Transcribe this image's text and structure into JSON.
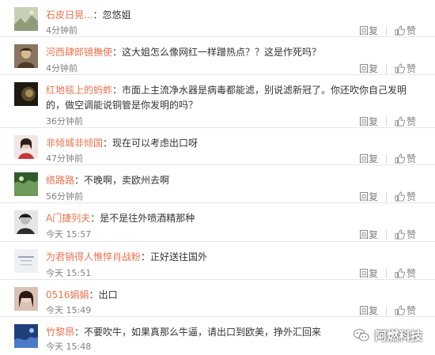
{
  "comments": [
    {
      "user": "石皮日晃...",
      "sep": "：",
      "text": "忽悠姐",
      "time": "4分钟前",
      "reply": "回复",
      "like": "赞",
      "avatar_color": "#9aa88a"
    },
    {
      "user": "河西肆郎镜撫使",
      "sep": "：",
      "text": "这大姐怎么像网红一样蹭热点？？这是作死吗？",
      "time": "4分钟前",
      "reply": "回复",
      "like": "赞",
      "avatar_color": "#6b5440"
    },
    {
      "user": "红地毯上的蚂蚱",
      "sep": "：",
      "text": "市面上主流净水器是病毒都能滤，别说滤新冠了。你还吹你自己发明的，做空调能说铜管是你发明的吗？",
      "time": "36分钟前",
      "reply": "回复",
      "like": "赞",
      "avatar_color": "#2e2618"
    },
    {
      "user": "非倾城非倾国",
      "sep": "：",
      "text": "现在可以考虑出口呀",
      "time": "47分钟前",
      "reply": "回复",
      "like": "赞",
      "avatar_color": "#c98a8a"
    },
    {
      "user": "络路路",
      "sep": "：",
      "text": "不晚啊，卖欧州去啊",
      "time": "56分钟前",
      "reply": "回复",
      "like": "赞",
      "avatar_color": "#4f7a48"
    },
    {
      "user": "A门捷列夫",
      "sep": "：",
      "text": "是不是往外喷酒精那种",
      "time": "今天 15:57",
      "reply": "回复",
      "like": "赞",
      "avatar_color": "#3a3a3a"
    },
    {
      "user": "为君销得人憔悴肖战粉",
      "sep": "：",
      "text": "正好送往国外",
      "time": "今天 15:51",
      "reply": "回复",
      "like": "赞",
      "avatar_color": "#d8dde4"
    },
    {
      "user": "0516娟娟",
      "sep": "：",
      "text": "出口",
      "time": "今天 15:49",
      "reply": "回复",
      "like": "赞",
      "avatar_color": "#b07a6a"
    },
    {
      "user": "竹黎昂",
      "sep": "：",
      "text": "不要吹牛，如果真那么牛逼，请出口到欧美，挣外汇回来",
      "time": "今天 15:48",
      "reply": "回复",
      "like": "赞",
      "avatar_color": "#3d5f9c"
    }
  ],
  "watermark": {
    "text": "阿燃科技",
    "icon": "wechat-icon"
  },
  "colors": {
    "username": "#eb7350",
    "muted": "#808080",
    "divider": "#e6e6e6"
  }
}
